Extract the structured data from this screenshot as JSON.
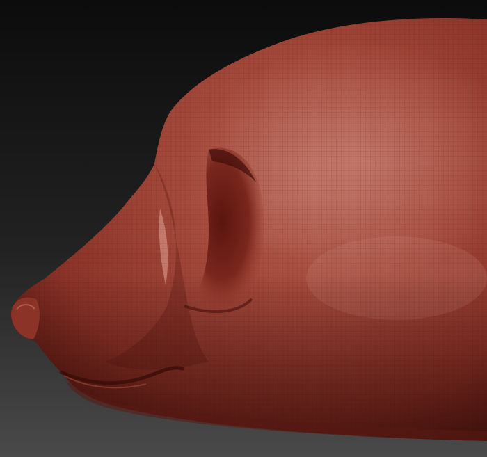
{
  "viewport": {
    "background_top": "#0c0c0c",
    "background_bottom": "#4a4a4a"
  },
  "model": {
    "subject": "sculpt-head-side-view",
    "material_base": "#9c4033",
    "material_shadow": "#4f140f",
    "material_highlight": "#c97b6e",
    "wireframe_color": "#3a0d09",
    "visible_wireframe": true
  }
}
